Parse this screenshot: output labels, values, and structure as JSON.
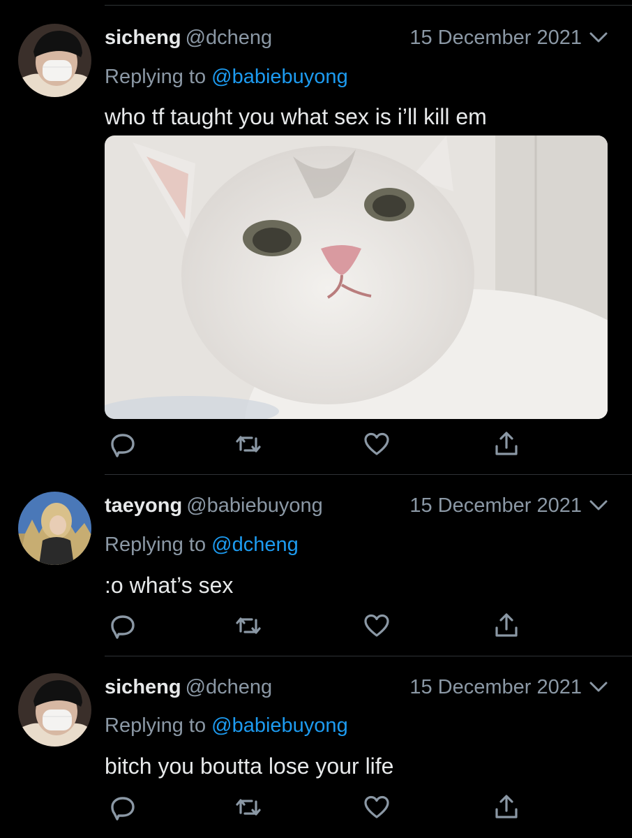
{
  "tweets": [
    {
      "name": "sicheng",
      "handle": "@dcheng",
      "date": "15 December 2021",
      "replying_prefix": "Replying to",
      "replying_to": "@babiebuyong",
      "text": "who tf taught you what sex is i’ll kill em",
      "has_media": true,
      "media_description": "white cat photo"
    },
    {
      "name": "taeyong",
      "handle": "@babiebuyong",
      "date": "15 December 2021",
      "replying_prefix": "Replying to",
      "replying_to": "@dcheng",
      "text": ":o what’s sex",
      "has_media": false
    },
    {
      "name": "sicheng",
      "handle": "@dcheng",
      "date": "15 December 2021",
      "replying_prefix": "Replying to",
      "replying_to": "@babiebuyong",
      "text": "bitch you boutta lose your life",
      "has_media": false
    }
  ],
  "icons": {
    "reply": "reply-icon",
    "retweet": "retweet-icon",
    "like": "heart-icon",
    "share": "share-icon",
    "more": "chevron-down-icon"
  },
  "colors": {
    "background": "#000000",
    "text": "#e7e9ea",
    "secondary": "#8b98a5",
    "accent": "#1d9bf0",
    "divider": "#2f3336"
  }
}
